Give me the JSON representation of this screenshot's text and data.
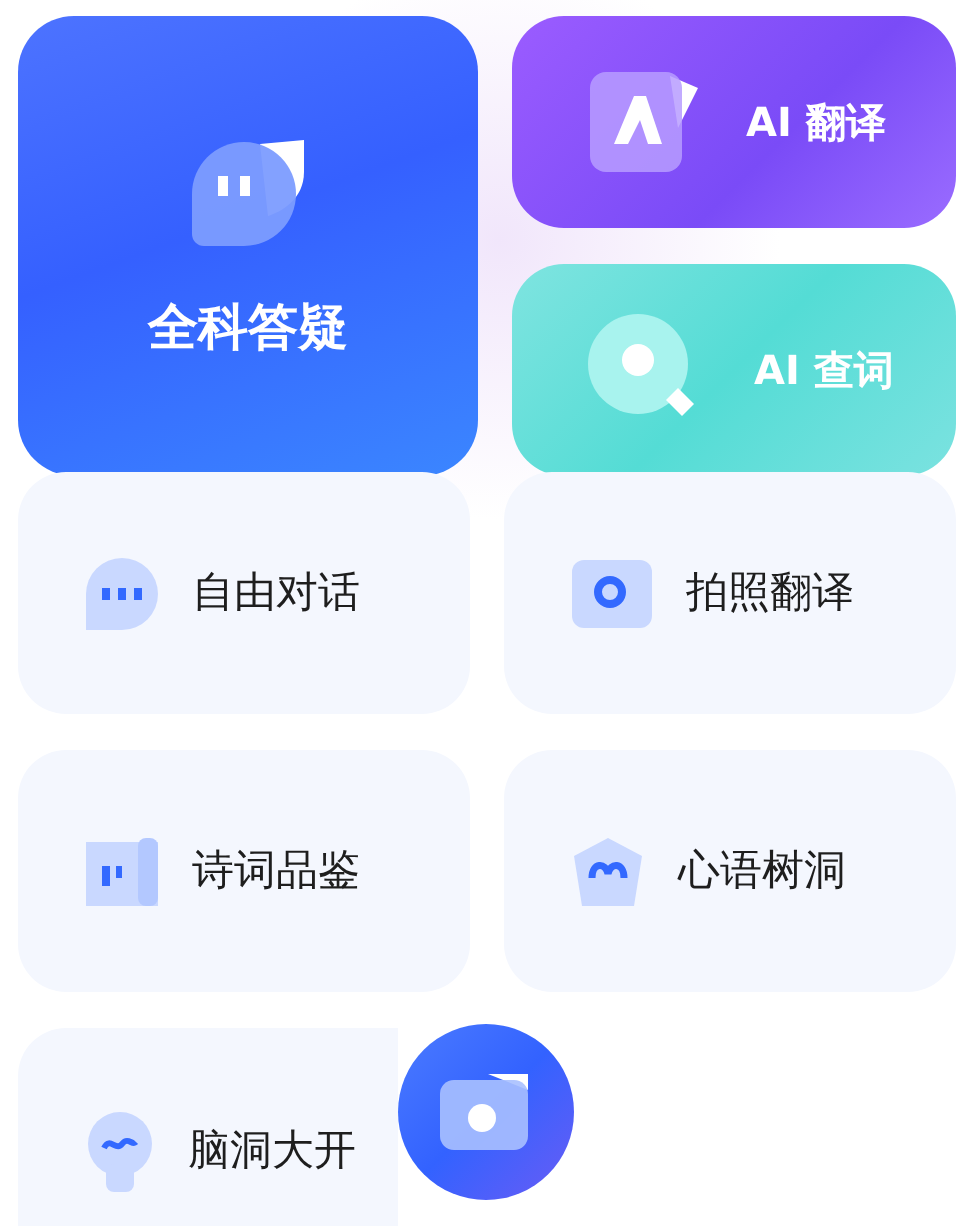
{
  "featured": {
    "title": "全科答疑"
  },
  "side_cards": [
    {
      "kind": "translate",
      "title": "AI 翻译"
    },
    {
      "kind": "lookup",
      "title": "AI 查词"
    }
  ],
  "tiles": [
    {
      "kind": "chat",
      "label": "自由对话"
    },
    {
      "kind": "photo",
      "label": "拍照翻译"
    },
    {
      "kind": "poem",
      "label": "诗词品鉴"
    },
    {
      "kind": "heart",
      "label": "心语树洞"
    },
    {
      "kind": "idea",
      "label": "脑洞大开"
    }
  ]
}
